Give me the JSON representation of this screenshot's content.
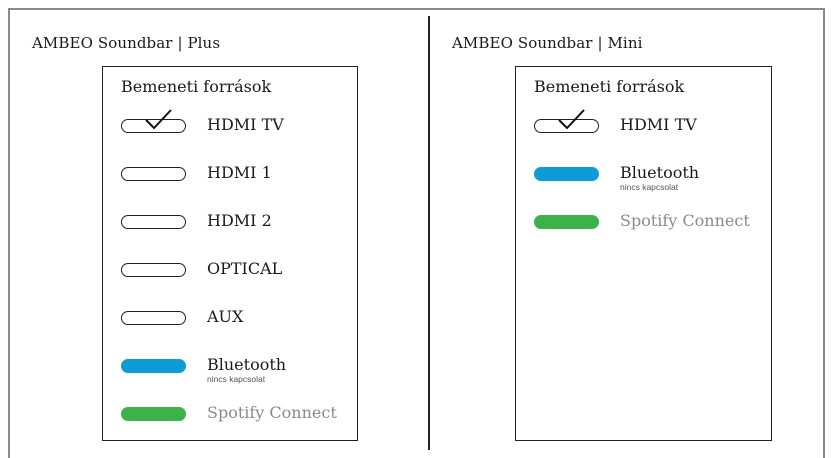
{
  "left_panel": {
    "title": "AMBEO Soundbar | Plus",
    "heading": "Bemeneti források",
    "sources": [
      {
        "label": "HDMI TV",
        "state": "selected"
      },
      {
        "label": "HDMI 1",
        "state": "off"
      },
      {
        "label": "HDMI 2",
        "state": "off"
      },
      {
        "label": "OPTICAL",
        "state": "off"
      },
      {
        "label": "AUX",
        "state": "off"
      },
      {
        "label": "Bluetooth",
        "sub": "nincs kapcsolat",
        "state": "blue"
      },
      {
        "label": "Spotify Connect",
        "state": "green"
      }
    ]
  },
  "right_panel": {
    "title": "AMBEO Soundbar | Mini",
    "heading": "Bemeneti források",
    "sources": [
      {
        "label": "HDMI TV",
        "state": "selected"
      },
      {
        "label": "Bluetooth",
        "sub": "nincs kapcsolat",
        "state": "blue"
      },
      {
        "label": "Spotify Connect",
        "state": "green"
      }
    ]
  },
  "colors": {
    "bluetooth": "#0e9bd8",
    "spotify": "#3bb34a",
    "muted_text": "#8a8a8a"
  }
}
